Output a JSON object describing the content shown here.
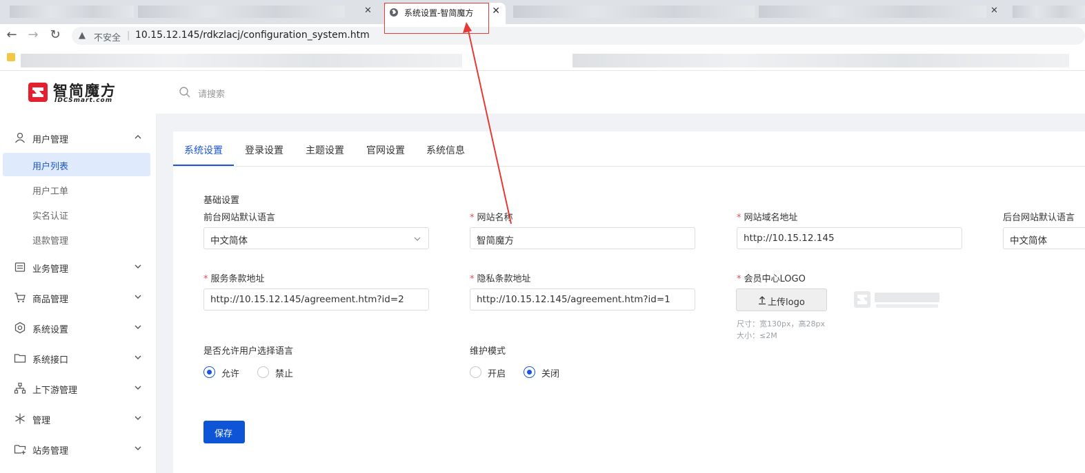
{
  "browser": {
    "active_tab_title": "系统设置-智简魔方",
    "address_insecure": "不安全",
    "url": "10.15.12.145/rdkzlacj/configuration_system.htm"
  },
  "header": {
    "logo_text_cn": "智简魔方",
    "logo_text_en": "IDCSmart.com",
    "search_placeholder": "请搜索"
  },
  "sidebar": {
    "groups": [
      {
        "label": "用户管理",
        "icon": "user-icon",
        "expanded": true,
        "items": [
          "用户列表",
          "用户工单",
          "实名认证",
          "退款管理"
        ],
        "active_item": "用户列表"
      },
      {
        "label": "业务管理",
        "icon": "list-icon"
      },
      {
        "label": "商品管理",
        "icon": "cart-icon"
      },
      {
        "label": "系统设置",
        "icon": "gear-icon"
      },
      {
        "label": "系统接口",
        "icon": "folder-icon"
      },
      {
        "label": "上下游管理",
        "icon": "hierarchy-icon"
      },
      {
        "label": "管理",
        "icon": "snowflake-icon"
      },
      {
        "label": "站务管理",
        "icon": "folder-plus-icon"
      }
    ]
  },
  "tabs": [
    "系统设置",
    "登录设置",
    "主题设置",
    "官网设置",
    "系统信息"
  ],
  "active_tab": "系统设置",
  "form": {
    "section_title": "基础设置",
    "frontend_lang_label": "前台网站默认语言",
    "frontend_lang_value": "中文简体",
    "site_name_label": "网站名称",
    "site_name_value": "智简魔方",
    "site_domain_label": "网站域名地址",
    "site_domain_value": "http://10.15.12.145",
    "backend_lang_label": "后台网站默认语言",
    "backend_lang_value": "中文简体",
    "terms_url_label": "服务条款地址",
    "terms_url_value": "http://10.15.12.145/agreement.htm?id=2",
    "privacy_url_label": "隐私条款地址",
    "privacy_url_value": "http://10.15.12.145/agreement.htm?id=1",
    "member_logo_label": "会员中心LOGO",
    "upload_button": "上传logo",
    "logo_size_hint": "尺寸：宽130px，高28px",
    "logo_filesize_hint": "大小：≤2M",
    "allow_lang_label": "是否允许用户选择语言",
    "allow_lang_options": [
      "允许",
      "禁止"
    ],
    "allow_lang_selected": "允许",
    "maintenance_label": "维护模式",
    "maintenance_options": [
      "开启",
      "关闭"
    ],
    "maintenance_selected": "关闭",
    "save_button": "保存"
  },
  "colors": {
    "primary": "#0d55d6",
    "annotation": "#e53935",
    "required": "#e34d59"
  }
}
